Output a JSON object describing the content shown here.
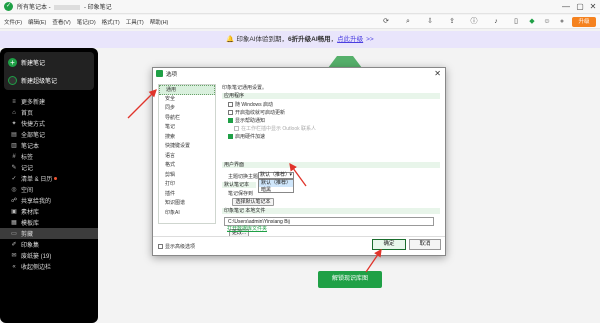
{
  "window": {
    "title_prefix": "所有笔记本 - ",
    "title_suffix": " - 印象笔记",
    "minimize_glyph": "—",
    "maximize_glyph": "▢",
    "close_glyph": "✕"
  },
  "menubar": {
    "items": [
      "文件(F)",
      "编辑(E)",
      "查看(V)",
      "笔记(O)",
      "格式(T)",
      "工具(T)",
      "帮助(H)"
    ],
    "toolbar_icons": [
      "sync-icon",
      "search-icon",
      "export-icon",
      "share-icon",
      "info-icon",
      "bell-icon",
      "phone-icon",
      "premium-icon",
      "robot-icon",
      "avatar-icon"
    ],
    "toolbar_glyphs": [
      "⟳",
      "⌕",
      "⇩",
      "⇪",
      "ⓘ",
      "♪",
      "▯",
      "◆",
      "☺",
      "●"
    ],
    "upgrade_label": "升级"
  },
  "banner": {
    "bell_glyph": "🔔",
    "text_before": "印象AI体验到期，",
    "text_bold": "6折升级AI畅用",
    "text_after": "，",
    "link_text": "点此升级",
    "chevron": ">>"
  },
  "sidebar": {
    "new_note_label": "新建笔记",
    "new_super_note_label": "新建超级笔记",
    "plus_glyph": "+",
    "items": [
      {
        "icon": "≡",
        "icon_name": "more-icon",
        "label": "更多新建"
      },
      {
        "icon": "⌂",
        "icon_name": "home-icon",
        "label": "首页"
      },
      {
        "icon": "✦",
        "icon_name": "shortcut-icon",
        "label": "快捷方式"
      },
      {
        "icon": "▤",
        "icon_name": "all-notes-icon",
        "label": "全部笔记"
      },
      {
        "icon": "▥",
        "icon_name": "notebook-icon",
        "label": "笔记本"
      },
      {
        "icon": "#",
        "icon_name": "tag-icon",
        "label": "标签"
      },
      {
        "icon": "✎",
        "icon_name": "journal-icon",
        "label": "记记"
      },
      {
        "icon": "✓",
        "icon_name": "tasks-icon",
        "label": "清单 & 日历"
      },
      {
        "icon": "◎",
        "icon_name": "space-icon",
        "label": "空间"
      },
      {
        "icon": "☍",
        "icon_name": "shared-icon",
        "label": "共享给我的"
      },
      {
        "icon": "▣",
        "icon_name": "material-icon",
        "label": "素材库"
      },
      {
        "icon": "▦",
        "icon_name": "template-icon",
        "label": "模板库"
      },
      {
        "icon": "▭",
        "icon_name": "clip-icon",
        "label": "剪藏"
      },
      {
        "icon": "✐",
        "icon_name": "stamp-icon",
        "label": "印象集"
      },
      {
        "icon": "✉",
        "icon_name": "draft-icon",
        "label": "废纸篓 (19)"
      },
      {
        "icon": "«",
        "icon_name": "collapse-icon",
        "label": "收起侧边栏"
      }
    ]
  },
  "main": {
    "button_label": "解锁现识库图"
  },
  "dialog": {
    "title": "选项",
    "close_glyph": "✕",
    "nav_items": [
      "通用",
      "安全",
      "同步",
      "导航栏",
      "笔记",
      "搜索",
      "快捷键设置",
      "语言",
      "格式",
      "剪辑",
      "打印",
      "插件",
      "知识图谱",
      "印象AI"
    ],
    "selected_nav": "通用",
    "headline": "印象笔记通用设置。",
    "sections": {
      "app": "应用程序",
      "ui": "用户界面",
      "default_notebook": "默认笔记本",
      "local_files": "印象笔记 本地文件"
    },
    "app_options": [
      {
        "label": "随 Windows 启动",
        "checked": false,
        "disabled": false
      },
      {
        "label": "开启指纹就可启动更新",
        "checked": false,
        "disabled": false
      },
      {
        "label": "显示帮助通知",
        "checked": true,
        "disabled": false
      },
      {
        "label": "在工作栏插中显示 Outlook 联系人",
        "checked": false,
        "disabled": true
      },
      {
        "label": "启用硬件加速",
        "checked": true,
        "disabled": false
      }
    ],
    "theme_label": "主题切换主题",
    "theme_value": "默认（推荐）",
    "theme_options": [
      "默认（推荐）",
      "暗黑"
    ],
    "default_notebook_label": "笔记保存到",
    "choose_notebook_button": "选择默认笔记本",
    "local_path": "C:\\Users\\admin\\Yinxiang Bij",
    "browse_button": "更改...",
    "open_folder_link": "打开数据库文件夹",
    "footer_checkbox_label": "显示高级选项",
    "ok_label": "确定",
    "cancel_label": "取消"
  },
  "colors": {
    "brand_green": "#1fa046",
    "annotation_red": "#e0342b",
    "upgrade_orange": "#f5821f",
    "banner_bg": "#e9e5fb"
  }
}
